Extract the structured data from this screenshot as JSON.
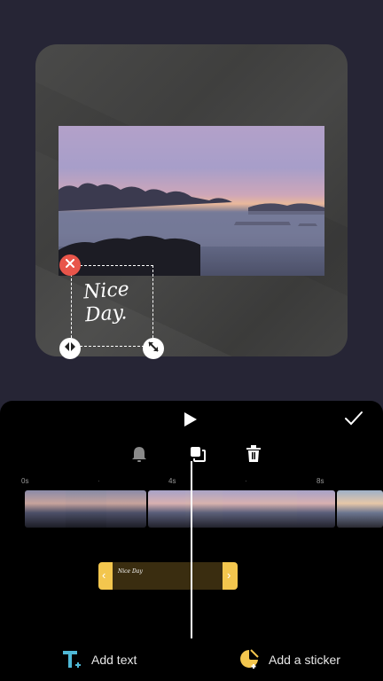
{
  "editor": {
    "sticker": {
      "text_line1": "Nice",
      "text_line2": "Day."
    }
  },
  "toolbar": {
    "play_icon": "play-icon",
    "confirm_icon": "checkmark-icon",
    "alarm_icon": "bell-icon",
    "layer_icon": "layer-copy-icon",
    "delete_icon": "trash-icon"
  },
  "timeline": {
    "ticks": [
      "0s",
      "4s",
      "8s"
    ],
    "sticker_track_thumb_text": "Nice Day"
  },
  "actions": {
    "add_text_label": "Add text",
    "add_sticker_label": "Add a sticker"
  },
  "colors": {
    "background": "#262535",
    "panel": "#000000",
    "accent_yellow": "#f3c64e",
    "delete_red": "#e8554a",
    "text_icon_blue": "#4fb8d6"
  }
}
